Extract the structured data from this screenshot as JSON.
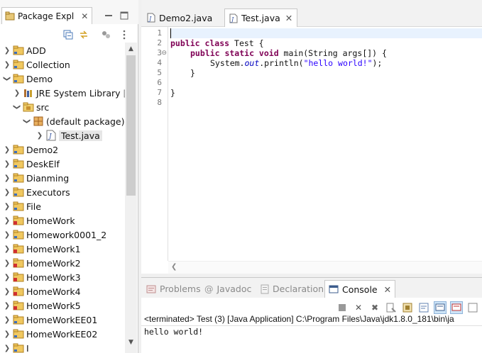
{
  "explorer": {
    "tab_title": "Package Expl",
    "items": [
      {
        "label": "ADD"
      },
      {
        "label": "Collection"
      },
      {
        "label": "Demo"
      },
      {
        "label": "JRE System Library",
        "suffix": "["
      },
      {
        "label": "src"
      },
      {
        "label": "(default package)"
      },
      {
        "label": "Test.java"
      },
      {
        "label": "Demo2"
      },
      {
        "label": "DeskElf"
      },
      {
        "label": "Dianming"
      },
      {
        "label": "Executors"
      },
      {
        "label": "File"
      },
      {
        "label": "HomeWork"
      },
      {
        "label": "Homework0001_2"
      },
      {
        "label": "HomeWork1"
      },
      {
        "label": "HomeWork2"
      },
      {
        "label": "HomeWork3"
      },
      {
        "label": "HomeWork4"
      },
      {
        "label": "HomeWork5"
      },
      {
        "label": "HomeWorkEE01"
      },
      {
        "label": "HomeWorkEE02"
      },
      {
        "label": "I"
      }
    ]
  },
  "editor": {
    "tabs": [
      {
        "label": "Demo2.java"
      },
      {
        "label": "Test.java"
      }
    ],
    "line_numbers": [
      "1",
      "2",
      "3",
      "4",
      "5",
      "6",
      "7",
      "8"
    ],
    "code": {
      "l2_kw": "public class",
      "l2_rest": " Test {",
      "l3_kw": "public static void",
      "l3_rest": " main(String args[]) {",
      "l4_a": "System.",
      "l4_out": "out",
      "l4_b": ".println(",
      "l4_str": "\"hello world!\"",
      "l4_c": ");",
      "l5": "}",
      "l7": "}"
    }
  },
  "console": {
    "tabs": [
      {
        "label": "Problems"
      },
      {
        "label": "Javadoc"
      },
      {
        "label": "Declaration"
      },
      {
        "label": "Console"
      }
    ],
    "status": "<terminated> Test (3) [Java Application] C:\\Program Files\\Java\\jdk1.8.0_181\\bin\\ja",
    "output": "hello world!"
  },
  "colors": {
    "keyword": "#7f0055",
    "string": "#2a00ff",
    "field": "#0000c0"
  }
}
